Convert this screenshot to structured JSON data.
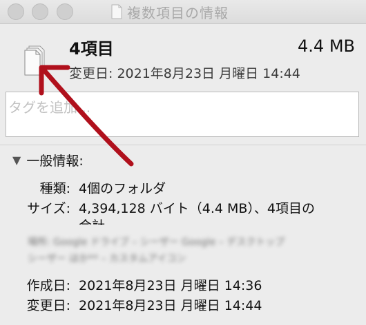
{
  "window": {
    "title": "複数項目の情報"
  },
  "summary": {
    "count": "4項目",
    "size": "4.4 MB",
    "modified": "変更日: 2021年8月23日 月曜日 14:44"
  },
  "tags": {
    "placeholder": "タグを追加..."
  },
  "general": {
    "header": "一般情報:",
    "disclosure": "▼",
    "kind_label": "種類:",
    "kind_value": "4個のフォルダ",
    "size_label": "サイズ:",
    "size_value_line1": "4,394,128 バイト（4.4 MB）、4項目の",
    "size_value_line2": "合計",
    "blurred_line1": "場所: Google ドライブ – シーザー Google – デスクトップ",
    "blurred_line2": "シーザー ほか** – カスタムアイコン",
    "created_label": "作成日:",
    "created_value": "2021年8月23日 月曜日 14:36",
    "modified_label": "変更日:",
    "modified_value": "2021年8月23日 月曜日 14:44"
  },
  "colors": {
    "arrow": "#b0101c"
  }
}
